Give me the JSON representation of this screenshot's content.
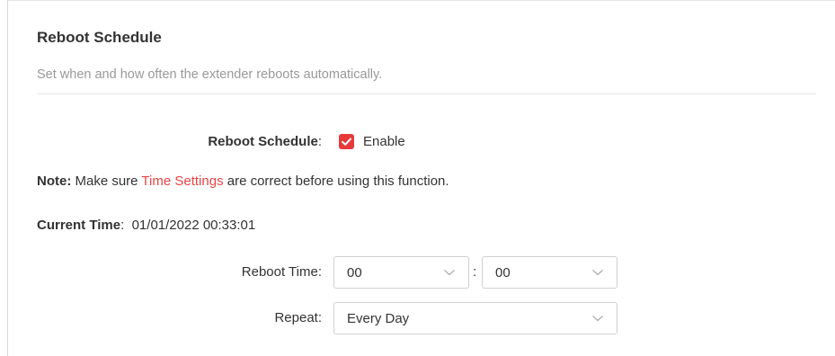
{
  "section": {
    "title": "Reboot Schedule",
    "description": "Set when and how often the extender reboots automatically."
  },
  "reboot_schedule": {
    "label": "Reboot Schedule",
    "colon": ":",
    "checkbox_checked": true,
    "checkbox_color": "#e63a3a",
    "checkbox_label": "Enable"
  },
  "note": {
    "prefix": "Note:",
    "text_before": " Make sure ",
    "link": "Time Settings",
    "text_after": " are correct before using this function.",
    "link_color": "#e64545"
  },
  "current_time": {
    "label": "Current Time",
    "colon": ":",
    "value": "01/01/2022 00:33:01"
  },
  "reboot_time": {
    "label": "Reboot Time:",
    "hour": "00",
    "separator": ":",
    "minute": "00",
    "chevron_icon": "chevron-down-icon"
  },
  "repeat": {
    "label": "Repeat:",
    "value": "Every Day",
    "chevron_icon": "chevron-down-icon"
  }
}
